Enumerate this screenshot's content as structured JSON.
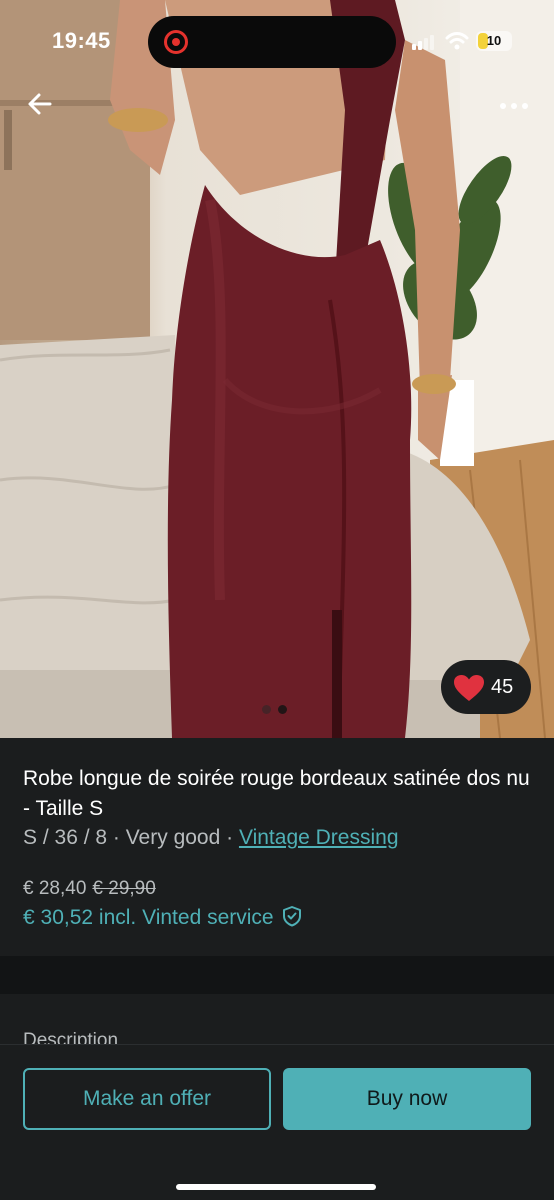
{
  "status_bar": {
    "time": "19:45",
    "battery": "10"
  },
  "product": {
    "title": "Robe longue de soirée rouge bordeaux satinée dos nu - Taille S",
    "size_condition": "S / 36 / 8 · Very good · ",
    "seller": "Vintage Dressing",
    "price": "€ 28,40",
    "old_price": "€ 29,90",
    "total_price": "€ 30,52 incl. Vinted service",
    "favorites": "45",
    "photo_count": 2,
    "current_photo": 1
  },
  "sections": {
    "description_label": "Description"
  },
  "actions": {
    "offer_label": "Make an offer",
    "buy_label": "Buy now"
  },
  "icons": {
    "back": "arrow-left-icon",
    "more": "more-horizontal-icon",
    "heart": "heart-icon",
    "shield": "shield-check-icon",
    "record": "screen-record-icon",
    "signal": "cellular-signal-icon",
    "wifi": "wifi-icon",
    "battery": "battery-icon"
  },
  "colors": {
    "accent": "#4fb0b6",
    "background": "#1b1d1e",
    "heart": "#e0323f",
    "dress": "#6b1e27",
    "recording": "#e5322d"
  }
}
